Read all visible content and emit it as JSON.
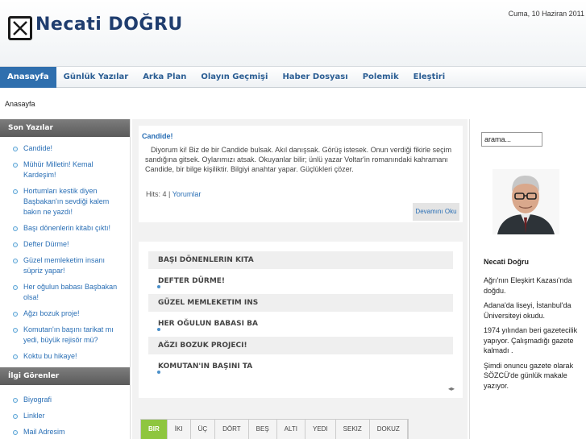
{
  "header": {
    "logo_text": "Necati DOĞRU",
    "date": "Cuma, 10 Haziran 2011"
  },
  "nav": [
    "Anasayfa",
    "Günlük Yazılar",
    "Arka Plan",
    "Olayın Geçmişi",
    "Haber Dosyası",
    "Polemik",
    "Eleştiri"
  ],
  "breadcrumb": "Anasayfa",
  "left_sidebar": {
    "recent_title": "Son Yazılar",
    "recent": [
      "Candide!",
      "Mühür Milletin! Kemal Kardeşim!",
      "Hortumları kestik diyen Başbakan'ın sevdiği kalem bakın ne yazdı!",
      "Başı dönenlerin kitabı çıktı!",
      "Defter Dürme!",
      "Güzel memleketim insanı süpriz yapar!",
      "Her oğulun babası Başbakan olsa!",
      "Ağzı bozuk proje!",
      "Komutan'ın başını tarikat mı yedi, büyük rejisör mü?",
      "Koktu bu hikaye!"
    ],
    "related_title": "İlgi Görenler",
    "related": [
      "Biyografi",
      "Linkler",
      "Mail Adresim"
    ]
  },
  "article": {
    "title": "Candide!",
    "body": "Diyorum ki! Biz de bir Candide bulsak. Akıl danışsak. Görüş istesek. Onun verdiği fikirle seçim sandığına gitsek. Oylarımızı atsak. Okuyanlar bilir; ünlü yazar Voltar'in romanındaki kahramanı Candide, bir bilge kişiliktir. Bilgiyi anahtar yapar. Güçlükleri çözer.",
    "hits": "Hits: 4 |",
    "comments": "Yorumlar",
    "readmore": "Devamını Oku"
  },
  "titles": [
    "BAŞI DÖNENLERIN KITA",
    "DEFTER DÜRME!",
    "GÜZEL MEMLEKETIM INS",
    "HER OĞULUN BABASI BA",
    "AĞZI BOZUK PROJECI!",
    "KOMUTAN'IN BAŞINI TA"
  ],
  "titles_nav": "◂▸",
  "pager": [
    "BIR",
    "İKI",
    "ÜÇ",
    "DÖRT",
    "BEŞ",
    "ALTI",
    "YEDI",
    "SEKIZ",
    "DOKUZ"
  ],
  "right_sidebar": {
    "search_value": "arama...",
    "bio_name": "Necati Doğru",
    "bio": [
      "Ağrı'nın Eleşkirt Kazası'nda doğdu.",
      "Adana'da liseyi, İstanbul'da Üniversiteyi okudu.",
      "1974 yılından beri gazetecilik yapıyor. Çalışmadığı gazete kalmadı .",
      "Şimdi onuncu gazete olarak SÖZCÜ'de günlük makale yazıyor."
    ]
  },
  "colors": {
    "nav_active": "#2f6fae",
    "link": "#2a6fb5",
    "pager_active": "#8ec63f"
  }
}
